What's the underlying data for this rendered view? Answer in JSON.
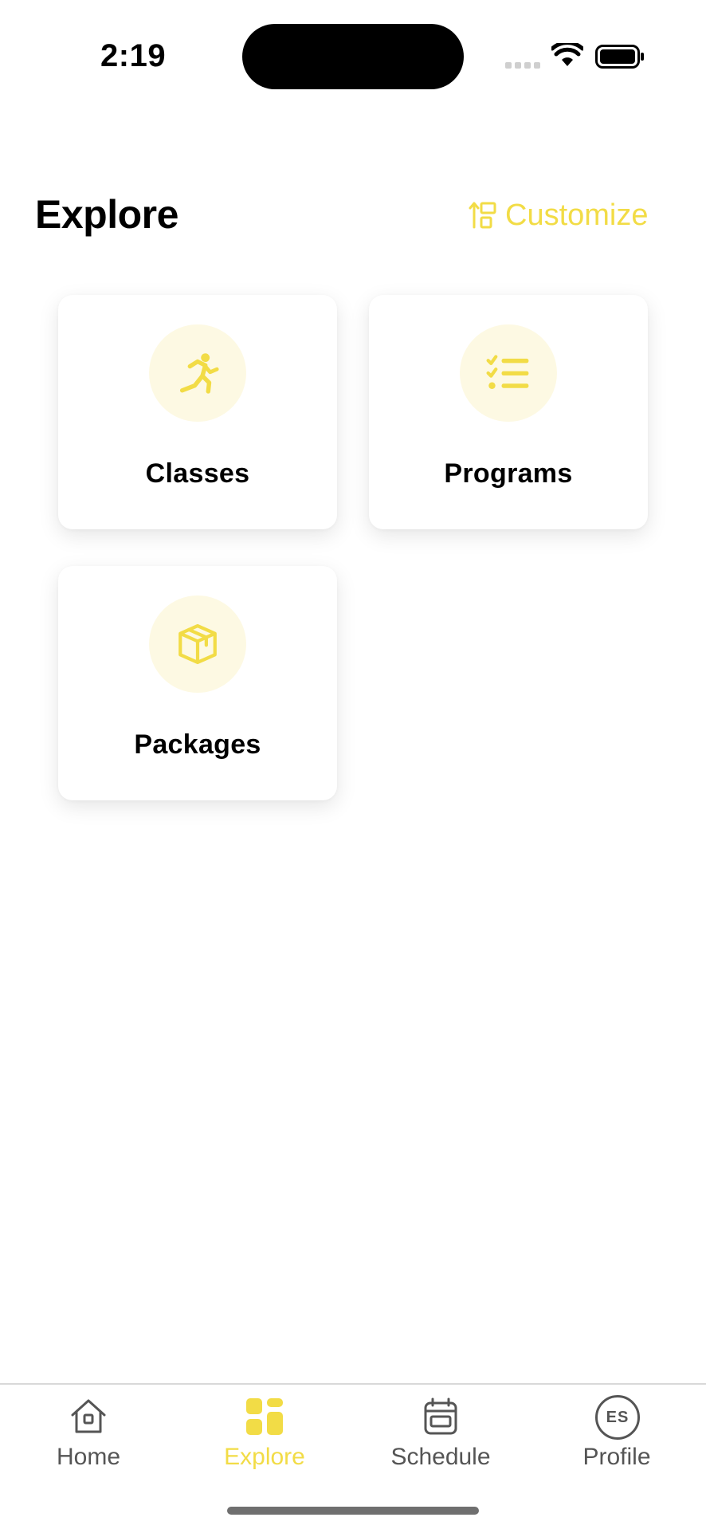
{
  "status_bar": {
    "time": "2:19",
    "icons": [
      "signal-icon",
      "wifi-icon",
      "battery-icon"
    ]
  },
  "header": {
    "title": "Explore",
    "customize_label": "Customize",
    "customize_icon": "sort-layout-icon"
  },
  "cards": [
    {
      "label": "Classes",
      "icon": "running-person-icon"
    },
    {
      "label": "Programs",
      "icon": "checklist-icon"
    },
    {
      "label": "Packages",
      "icon": "package-box-icon"
    }
  ],
  "tab_bar": {
    "tabs": [
      {
        "label": "Home",
        "icon": "home-icon",
        "active": false
      },
      {
        "label": "Explore",
        "icon": "explore-grid-icon",
        "active": true
      },
      {
        "label": "Schedule",
        "icon": "calendar-icon",
        "active": false
      },
      {
        "label": "Profile",
        "icon": "avatar",
        "active": false
      }
    ],
    "profile_initials": "ES"
  },
  "colors": {
    "accent": "#f2dc46",
    "icon_circle_bg": "#fdf9e3",
    "tab_inactive": "#555555",
    "text": "#000000"
  }
}
